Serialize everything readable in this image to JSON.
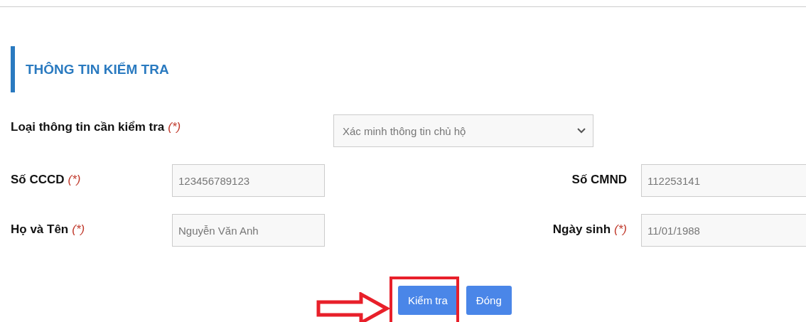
{
  "section": {
    "title": "THÔNG TIN KIỂM TRA"
  },
  "info_type": {
    "label": "Loại thông tin cần kiểm tra",
    "required_mark": "(*)",
    "value": "Xác minh thông tin chủ hộ"
  },
  "rows": [
    {
      "left": {
        "label": "Số CCCD",
        "required_mark": "(*)",
        "value": "123456789123"
      },
      "right": {
        "label": "Số CMND",
        "value": "112253141"
      }
    },
    {
      "left": {
        "label": "Họ và Tên",
        "required_mark": "(*)",
        "value": "Nguyễn Văn Anh"
      },
      "right": {
        "label": "Ngày sinh",
        "required_mark": "(*)",
        "value": "11/01/1988"
      }
    }
  ],
  "buttons": [
    {
      "label": "Kiểm tra",
      "highlighted": true
    },
    {
      "label": "Đóng",
      "highlighted": false
    }
  ]
}
